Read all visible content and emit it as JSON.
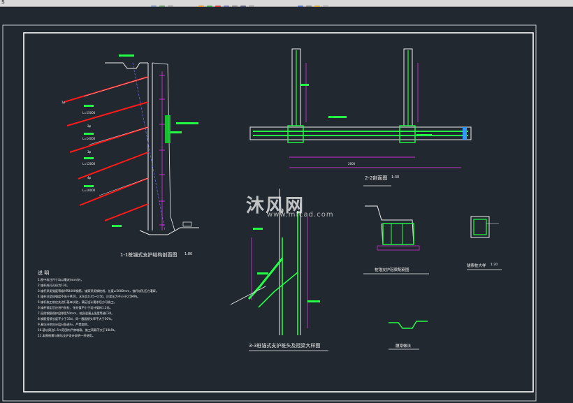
{
  "window": {
    "file_tab": "s",
    "toolbar_icons": [
      "layer-icon",
      "undo-icon",
      "redo-icon",
      "color-icon",
      "snap-icon",
      "pan-icon",
      "zoom-icon",
      "properties-icon",
      "print-icon",
      "save-icon",
      "open-icon"
    ]
  },
  "drawing": {
    "section_1_1_title": "1-1桩锚式支护结构剖面图",
    "section_1_1_scale": "1:80",
    "section_2_2_title": "2-2剖面图",
    "section_2_2_scale": "1:30",
    "section_3_3_title": "3-3桩锚式支护桩头及冠梁大样图",
    "cap_beam_title": "桩锚支护冠梁配筋图",
    "pile_detail_title": "锚索桩大样",
    "pile_detail_scale": "1:20",
    "waler_title": "腰梁做法",
    "dim_2600": "2600",
    "notes_heading": "说  明",
    "notes": [
      "1.图中标注尺寸均以毫米(mm)计。",
      "2.锚杆成孔孔径为130。",
      "3.锚杆采用强度等级HRB400钢筋，锚索采用钢绞线，长度≥5000mm，锚杆成孔压力灌浆。",
      "4.锚杆注浆体强度不低于M20，水灰比0.45~0.50，注浆压力不小于0.5MPa。",
      "5.锚杆施工前应先进行基本试验，满足设计要求后方可施工。",
      "6.锚杆锁定后应进行张拉，张拉值不小于设计值的1.2倍。",
      "7.冠梁钢筋保护层厚度50mm，桩身混凝土强度等级C30。",
      "8.钢筋搭接长度不小于35d，同一截面接头率不大于50%。",
      "9.基坑开挖应分层分段进行，严禁超挖。",
      "10.基坑周边1.5m范围内严禁堆载，施工荷载不大于10kPa。",
      "11.本图纸需与基坑支护设计说明一并使用。"
    ],
    "anchor_labels": [
      "1φ",
      "L=15000",
      "2φ",
      "L=14000",
      "3φ",
      "L=12000",
      "4φ",
      "L=10000"
    ],
    "watermark": "沐风网",
    "watermark_url": "www.mfcad.com",
    "colors": {
      "background": "#212830",
      "frame": "#ffffff",
      "anchor": "#ff1a1a",
      "rebar": "#00ff33",
      "dimension": "#ff33ff",
      "text_green": "#22ff44",
      "toolbar": "#d9d9d9"
    }
  }
}
